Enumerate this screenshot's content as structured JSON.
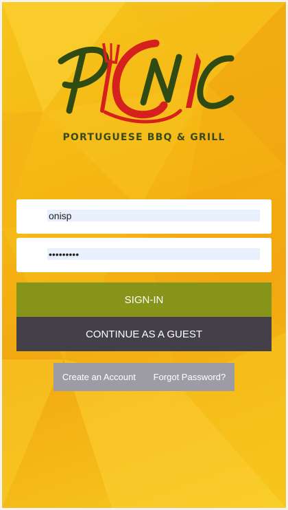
{
  "brand": {
    "logo_text": "PICNIC",
    "tagline": "PORTUGUESE BBQ & GRILL"
  },
  "login": {
    "username_value": "onisp",
    "password_value": "•••••••••"
  },
  "buttons": {
    "sign_in": "SIGN-IN",
    "guest": "CONTINUE AS A GUEST"
  },
  "links": {
    "create_account": "Create an Account",
    "forgot_password": "Forgot Password?"
  },
  "colors": {
    "background": "#f5b614",
    "sign_in_button": "#869419",
    "guest_button": "#434049",
    "links_bar": "#9d9ca5",
    "logo_dark": "#2f4a12",
    "logo_red": "#d5201e"
  }
}
